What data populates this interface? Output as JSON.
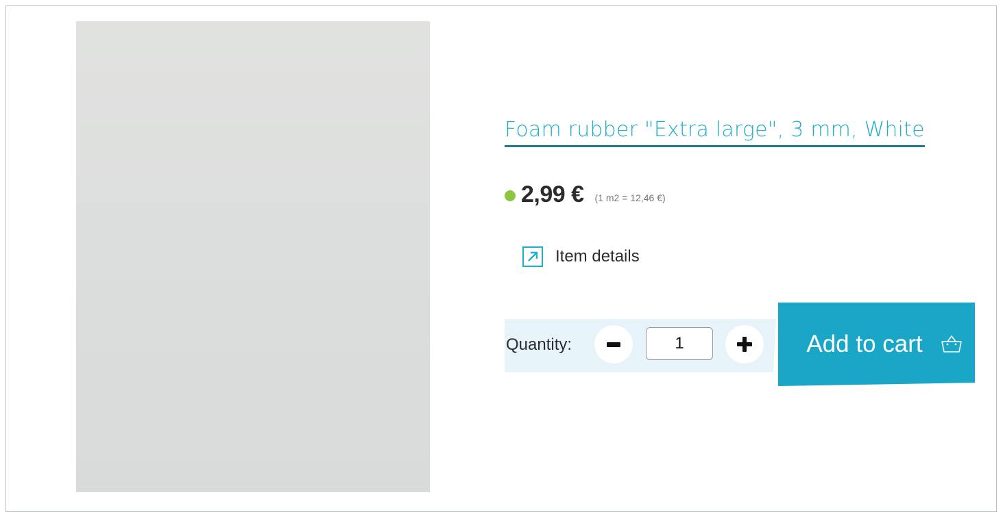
{
  "product": {
    "title": "Foam rubber \"Extra large\", 3 mm, White",
    "price": "2,99 €",
    "unit_price": "(1 m2 = 12,46 €)",
    "availability_color": "#8cc63f"
  },
  "details": {
    "label": "Item details",
    "icon": "external-link-arrow-icon"
  },
  "quantity": {
    "label": "Quantity:",
    "value": "1",
    "minus_icon": "minus-icon",
    "plus_icon": "plus-icon"
  },
  "cart": {
    "label": "Add to cart",
    "icon": "basket-icon"
  },
  "colors": {
    "accent": "#20aec9",
    "cart_button": "#1aa6c6",
    "quantity_panel": "#e6f4fa",
    "text": "#2c2c2c"
  }
}
